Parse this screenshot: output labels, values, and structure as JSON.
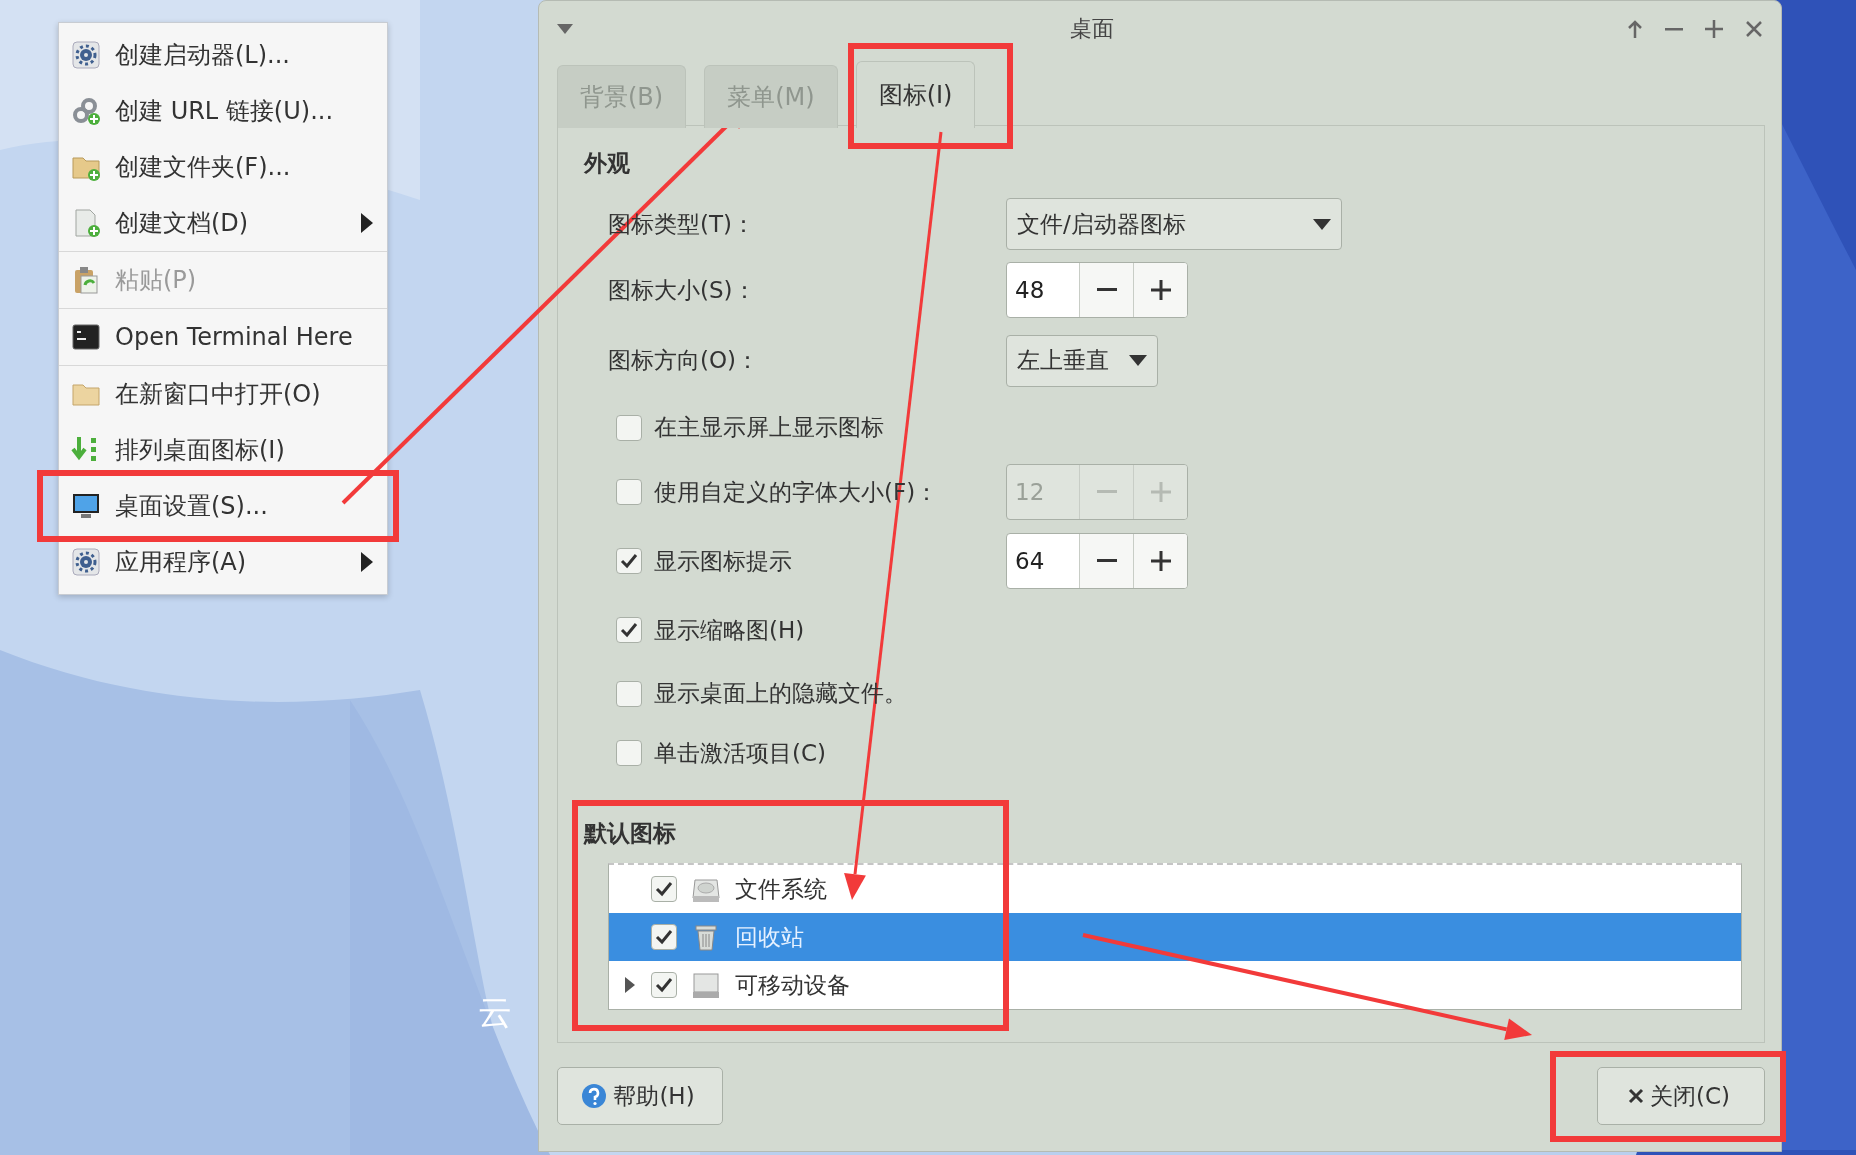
{
  "desktop": {
    "label": "云"
  },
  "context_menu": {
    "groups": [
      [
        {
          "label": "创建启动器(L)...",
          "disabled": false,
          "submenu": false
        },
        {
          "label": "创建 URL 链接(U)...",
          "disabled": false,
          "submenu": false
        },
        {
          "label": "创建文件夹(F)...",
          "disabled": false,
          "submenu": false
        },
        {
          "label": "创建文档(D)",
          "disabled": false,
          "submenu": true
        }
      ],
      [
        {
          "label": "粘贴(P)",
          "disabled": true,
          "submenu": false
        }
      ],
      [
        {
          "label": "Open Terminal Here",
          "disabled": false,
          "submenu": false
        }
      ],
      [
        {
          "label": "在新窗口中打开(O)",
          "disabled": false,
          "submenu": false
        },
        {
          "label": "排列桌面图标(I)",
          "disabled": false,
          "submenu": false
        },
        {
          "label": "桌面设置(S)...",
          "disabled": false,
          "submenu": false
        },
        {
          "label": "应用程序(A)",
          "disabled": false,
          "submenu": true
        }
      ]
    ]
  },
  "window": {
    "title": "桌面"
  },
  "tabs": [
    {
      "label": "背景(B)",
      "selected": false
    },
    {
      "label": "菜单(M)",
      "selected": false
    },
    {
      "label": "图标(I)",
      "selected": true
    }
  ],
  "appearance": {
    "title": "外观",
    "rows": [
      {
        "kind": "dropdown",
        "label": "图标类型(T)：",
        "value": "文件/启动器图标"
      },
      {
        "kind": "spin",
        "label": "图标大小(S)：",
        "value": "48",
        "disabled": false
      },
      {
        "kind": "dropdown",
        "label": "图标方向(O)：",
        "value": "左上垂直"
      },
      {
        "kind": "checkbox",
        "label": "在主显示屏上显示图标",
        "checked": false
      },
      {
        "kind": "checkspin",
        "label": "使用自定义的字体大小(F)：",
        "checked": false,
        "value": "12",
        "disabled": true
      },
      {
        "kind": "checkspin",
        "label": "显示图标提示",
        "checked": true,
        "value": "64",
        "disabled": false
      },
      {
        "kind": "checkbox",
        "label": "显示缩略图(H)",
        "checked": true
      },
      {
        "kind": "checkbox",
        "label": "显示桌面上的隐藏文件。",
        "checked": false
      },
      {
        "kind": "checkbox",
        "label": "单击激活项目(C)",
        "checked": false
      }
    ]
  },
  "default_icons": {
    "title": "默认图标",
    "items": [
      {
        "label": "文件系统",
        "checked": true,
        "selected": false
      },
      {
        "label": "回收站",
        "checked": true,
        "selected": true
      },
      {
        "label": "可移动设备",
        "checked": true,
        "selected": false,
        "expanded": false
      }
    ]
  },
  "buttons": [
    {
      "kind": "help",
      "label": "帮助(H)"
    },
    {
      "kind": "close",
      "label": "关闭(C)"
    }
  ],
  "annotations": [
    {
      "kind": "box"
    },
    {
      "kind": "box"
    },
    {
      "kind": "box"
    },
    {
      "kind": "box"
    },
    {
      "kind": "arrow"
    },
    {
      "kind": "arrow"
    },
    {
      "kind": "arrow"
    }
  ]
}
